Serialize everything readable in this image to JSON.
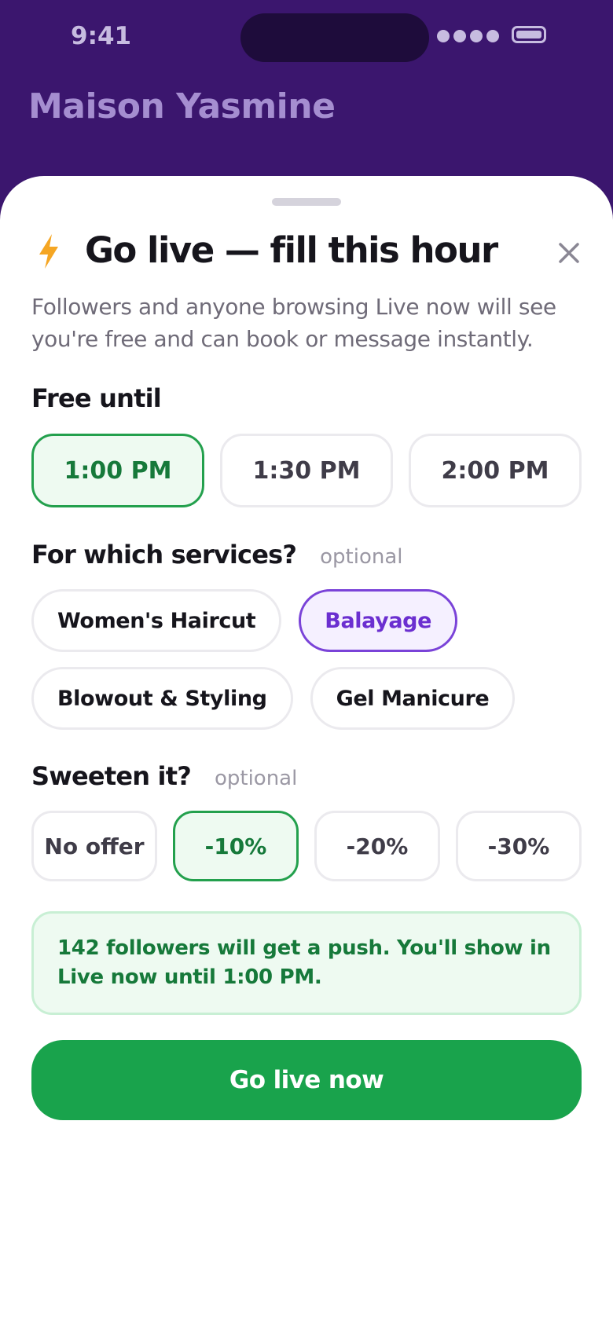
{
  "status_bar": {
    "time": "9:41"
  },
  "background": {
    "title": "Maison Yasmine"
  },
  "sheet": {
    "title": "Go live — fill this hour",
    "subtitle": "Followers and anyone browsing Live now will see you're free and can book or message instantly.",
    "free_until": {
      "label": "Free until",
      "options": [
        "1:00 PM",
        "1:30 PM",
        "2:00 PM"
      ],
      "selected": "1:00 PM"
    },
    "services": {
      "label": "For which services?",
      "optional": "optional",
      "options": [
        "Women's Haircut",
        "Balayage",
        "Blowout & Styling",
        "Gel Manicure"
      ],
      "selected": "Balayage"
    },
    "offer": {
      "label": "Sweeten it?",
      "optional": "optional",
      "options": [
        "No offer",
        "-10%",
        "-20%",
        "-30%"
      ],
      "selected": "-10%"
    },
    "notice": "142 followers will get a push. You'll show in Live now until 1:00 PM.",
    "cta_label": "Go live now"
  },
  "colors": {
    "background": "#3b166e",
    "accent_green": "#19a34c",
    "accent_purple": "#6b2fd0",
    "bolt": "#f5a623"
  },
  "icons": [
    "lightning-bolt-icon",
    "close-icon",
    "signal-icon",
    "battery-icon"
  ]
}
